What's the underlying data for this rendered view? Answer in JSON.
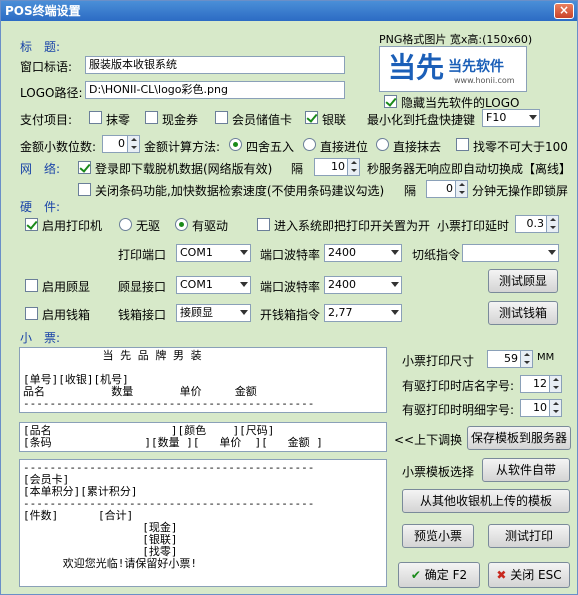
{
  "window": {
    "title": "POS终端设置",
    "close": "×"
  },
  "logo_panel": {
    "caption": "PNG格式图片 宽x高:(150x60)",
    "brand_cn": "当先软件",
    "brand_glyph": "当先",
    "url": "www.honii.com",
    "hide_label": "隐藏当先软件的LOGO"
  },
  "title_section": {
    "heading": "标　题:",
    "window_title_label": "窗口标语:",
    "window_title_value": "服装版本收银系统",
    "logo_path_label": "LOGO路径:",
    "logo_path_value": "D:\\HONII-CL\\logo彩色.png"
  },
  "payment": {
    "label": "支付项目:",
    "items": [
      "抹零",
      "现金券",
      "会员储值卡",
      "银联"
    ],
    "tray_label": "最小化到托盘快捷键",
    "tray_value": "F10"
  },
  "amount": {
    "decimals_label": "金额小数位数:",
    "decimals_value": "0",
    "method_label": "金额计算方法:",
    "methods": [
      "四舍五入",
      "直接进位",
      "直接抹去"
    ],
    "change_limit": "找零不可大于100"
  },
  "network": {
    "heading": "网　络:",
    "download_label": "登录即下载脱机数据(网络版有效)",
    "interval_label": "隔",
    "interval_value": "10",
    "auto_switch": "秒服务器无响应即自动切换成【离线】",
    "barcode_label": "关闭条码功能,加快数据检索速度(不使用条码建议勾选)",
    "lock_interval_label": "隔",
    "lock_value": "0",
    "lock_suffix": "分钟无操作即锁屏"
  },
  "hardware": {
    "heading": "硬　件:",
    "printer_label": "启用打印机",
    "no_driver": "无驱",
    "with_driver": "有驱动",
    "close_on_enter": "进入系统即把打印开关置为开",
    "delay_label": "小票打印延时",
    "delay_value": "0.3",
    "print_port_label": "打印端口",
    "print_port_value": "COM1",
    "print_baud_label": "端口波特率",
    "print_baud_value": "2400",
    "cut_label": "切纸指令",
    "cut_value": "",
    "display_label": "启用顾显",
    "display_port_label": "顾显接口",
    "display_port_value": "COM1",
    "display_baud_label": "端口波特率",
    "display_baud_value": "2400",
    "test_display": "测试顾显",
    "cashbox_label": "启用钱箱",
    "cashbox_port_label": "钱箱接口",
    "cashbox_port_value": "接顾显",
    "cashbox_cmd_label": "开钱箱指令",
    "cashbox_cmd_value": "2,77",
    "test_cashbox": "测试钱箱"
  },
  "receipt": {
    "heading": "小　票:",
    "header_text": "            当 先 品 牌 男 装\n\n[单号][收银][机号]\n品名          数量       单价     金额\n--------------------------------------------",
    "item_text": "[品名                  ][颜色    ][尺码]\n[条码              ][数量 ][   单价  ][   金额 ]",
    "footer_text": "--------------------------------------------\n[会员卡]\n[本单积分][累计积分]\n--------------------------------------------\n[件数]      [合计]\n                  [现金]\n                  [银联]\n                  [找零]\n      欢迎您光临!请保留好小票!",
    "size_label": "小票打印尺寸",
    "size_value": "59",
    "size_unit": "MM",
    "store_font_label": "有驱打印时店名字号:",
    "store_font_value": "12",
    "detail_font_label": "有驱打印时明细字号:",
    "detail_font_value": "10",
    "swap_label": "<<上下调换",
    "save_template": "保存模板到服务器",
    "template_select_label": "小票模板选择",
    "from_software": "从软件自带",
    "from_other": "从其他收银机上传的模板",
    "preview": "预览小票",
    "test_print": "测试打印"
  },
  "footer": {
    "ok": "确定 F2",
    "close": "关闭 ESC"
  },
  "colors": {
    "background": "#d7e9c9",
    "section": "#1a44a8",
    "title_bar": "#2c6bc4"
  }
}
